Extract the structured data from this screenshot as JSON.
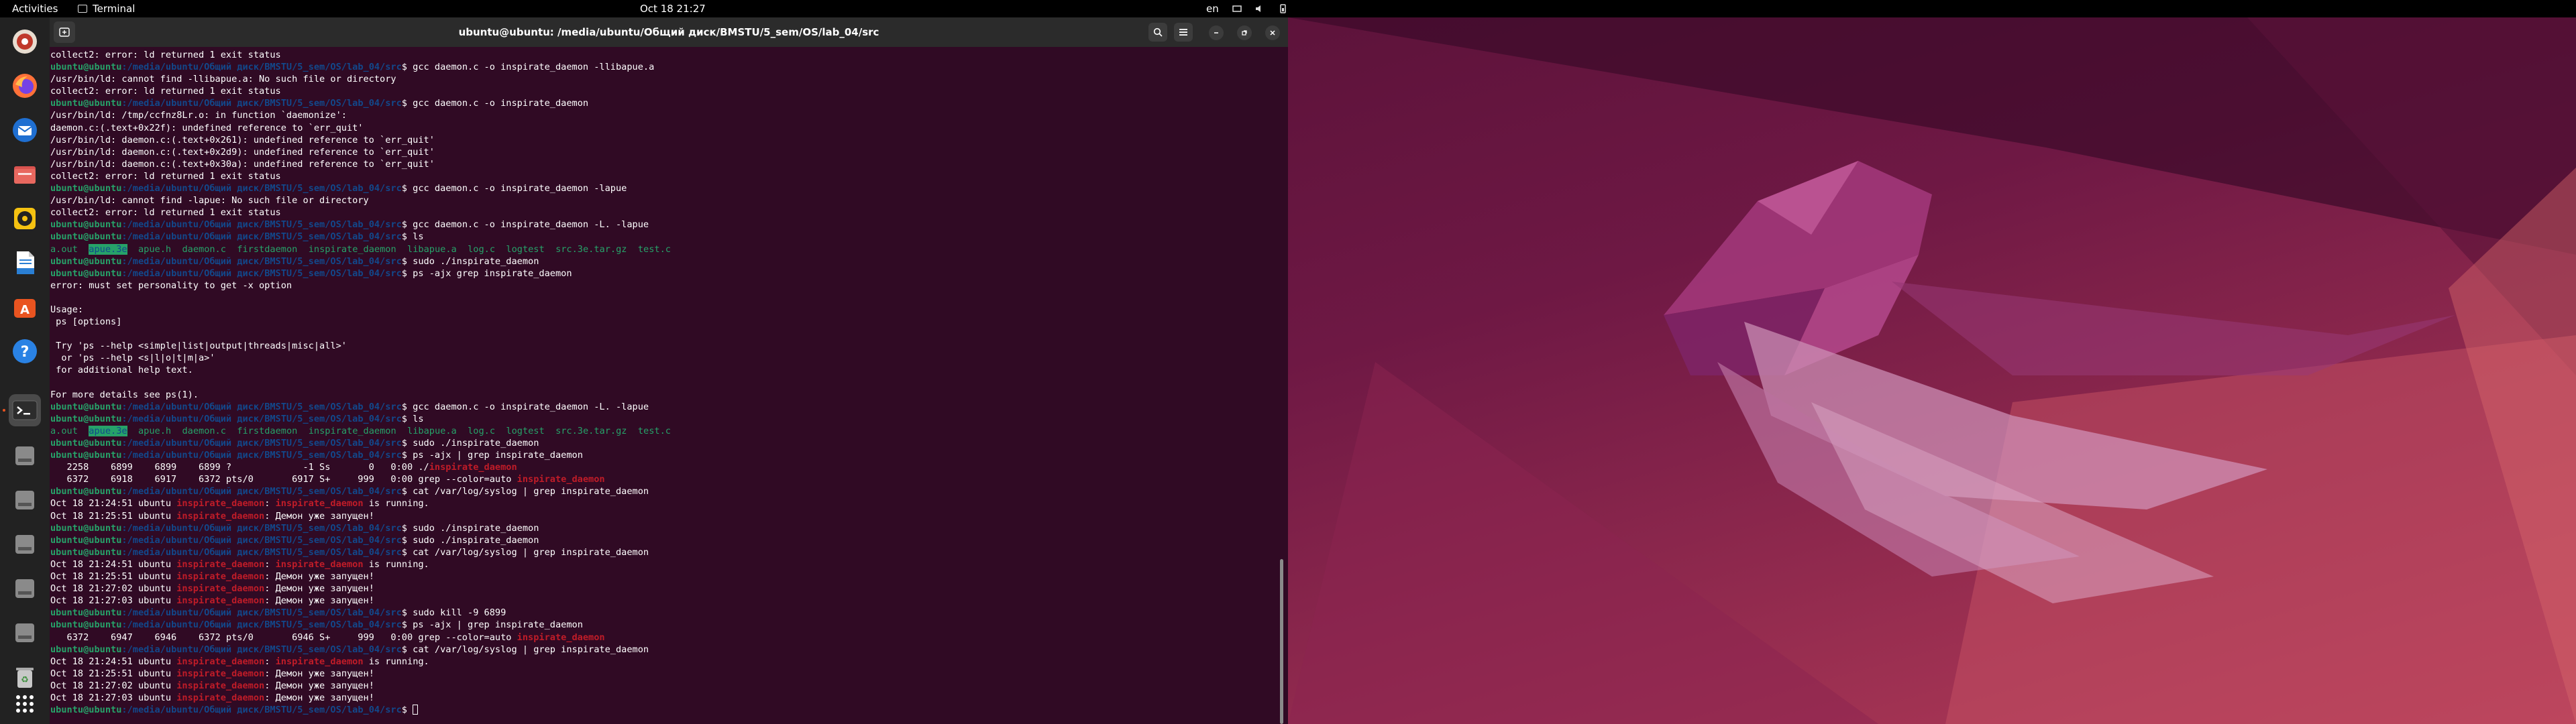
{
  "topbar": {
    "activities": "Activities",
    "app_name": "Terminal",
    "clock": "Oct 18  21:27",
    "keyboard_layout": "en"
  },
  "dock": {
    "icons": [
      "helper-app-icon",
      "firefox-icon",
      "thunderbird-icon",
      "files-icon",
      "rhythmbox-icon",
      "libreoffice-writer-icon",
      "app-center-icon",
      "help-icon",
      "terminal-icon",
      "drive-icon",
      "drive-icon",
      "drive-icon",
      "drive-icon",
      "drive-icon",
      "trash-icon",
      "show-apps-icon"
    ]
  },
  "window": {
    "title": "ubuntu@ubuntu: /media/ubuntu/Общий диск/BMSTU/5_sem/OS/lab_04/src"
  },
  "terminal": {
    "prompt_user": "ubuntu@ubuntu",
    "prompt_path": ":/media/ubuntu/Общий диск/BMSTU/5_sem/OS/lab_04/src",
    "lines": [
      [
        {
          "t": "collect2: error: ld returned 1 exit status"
        }
      ],
      [
        {
          "t": "ubuntu@ubuntu",
          "c": "p-user"
        },
        {
          "t": ":/media/ubuntu/Общий диск/BMSTU/5_sem/OS/lab_04/src",
          "c": "p-path"
        },
        {
          "t": "$ gcc daemon.c -o inspirate_daemon -llibapue.a"
        }
      ],
      [
        {
          "t": "/usr/bin/ld: cannot find -llibapue.a: No such file or directory"
        }
      ],
      [
        {
          "t": "collect2: error: ld returned 1 exit status"
        }
      ],
      [
        {
          "t": "ubuntu@ubuntu",
          "c": "p-user"
        },
        {
          "t": ":/media/ubuntu/Общий диск/BMSTU/5_sem/OS/lab_04/src",
          "c": "p-path"
        },
        {
          "t": "$ gcc daemon.c -o inspirate_daemon"
        }
      ],
      [
        {
          "t": "/usr/bin/ld: /tmp/ccfnz8Lr.o: in function `daemonize':"
        }
      ],
      [
        {
          "t": "daemon.c:(.text+0x22f): undefined reference to `err_quit'"
        }
      ],
      [
        {
          "t": "/usr/bin/ld: daemon.c:(.text+0x261): undefined reference to `err_quit'"
        }
      ],
      [
        {
          "t": "/usr/bin/ld: daemon.c:(.text+0x2d9): undefined reference to `err_quit'"
        }
      ],
      [
        {
          "t": "/usr/bin/ld: daemon.c:(.text+0x30a): undefined reference to `err_quit'"
        }
      ],
      [
        {
          "t": "collect2: error: ld returned 1 exit status"
        }
      ],
      [
        {
          "t": "ubuntu@ubuntu",
          "c": "p-user"
        },
        {
          "t": ":/media/ubuntu/Общий диск/BMSTU/5_sem/OS/lab_04/src",
          "c": "p-path"
        },
        {
          "t": "$ gcc daemon.c -o inspirate_daemon -lapue"
        }
      ],
      [
        {
          "t": "/usr/bin/ld: cannot find -lapue: No such file or directory"
        }
      ],
      [
        {
          "t": "collect2: error: ld returned 1 exit status"
        }
      ],
      [
        {
          "t": "ubuntu@ubuntu",
          "c": "p-user"
        },
        {
          "t": ":/media/ubuntu/Общий диск/BMSTU/5_sem/OS/lab_04/src",
          "c": "p-path"
        },
        {
          "t": "$ gcc daemon.c -o inspirate_daemon -L. -lapue"
        }
      ],
      [
        {
          "t": "ubuntu@ubuntu",
          "c": "p-user"
        },
        {
          "t": ":/media/ubuntu/Общий диск/BMSTU/5_sem/OS/lab_04/src",
          "c": "p-path"
        },
        {
          "t": "$ ls"
        }
      ],
      [
        {
          "t": "a.out",
          "c": "g"
        },
        {
          "t": "  "
        },
        {
          "t": "apue.3e",
          "c": "dir"
        },
        {
          "t": "  "
        },
        {
          "t": "apue.h",
          "c": "g"
        },
        {
          "t": "  "
        },
        {
          "t": "daemon.c",
          "c": "g"
        },
        {
          "t": "  "
        },
        {
          "t": "firstdaemon",
          "c": "g"
        },
        {
          "t": "  "
        },
        {
          "t": "inspirate_daemon",
          "c": "g"
        },
        {
          "t": "  "
        },
        {
          "t": "libapue.a",
          "c": "g"
        },
        {
          "t": "  "
        },
        {
          "t": "log.c",
          "c": "g"
        },
        {
          "t": "  "
        },
        {
          "t": "logtest",
          "c": "g"
        },
        {
          "t": "  "
        },
        {
          "t": "src.3e.tar.gz",
          "c": "g"
        },
        {
          "t": "  "
        },
        {
          "t": "test.c",
          "c": "g"
        }
      ],
      [
        {
          "t": "ubuntu@ubuntu",
          "c": "p-user"
        },
        {
          "t": ":/media/ubuntu/Общий диск/BMSTU/5_sem/OS/lab_04/src",
          "c": "p-path"
        },
        {
          "t": "$ sudo ./inspirate_daemon"
        }
      ],
      [
        {
          "t": "ubuntu@ubuntu",
          "c": "p-user"
        },
        {
          "t": ":/media/ubuntu/Общий диск/BMSTU/5_sem/OS/lab_04/src",
          "c": "p-path"
        },
        {
          "t": "$ ps -ajx grep inspirate_daemon"
        }
      ],
      [
        {
          "t": "error: must set personality to get -x option"
        }
      ],
      [
        {
          "t": ""
        }
      ],
      [
        {
          "t": "Usage:"
        }
      ],
      [
        {
          "t": " ps [options]"
        }
      ],
      [
        {
          "t": ""
        }
      ],
      [
        {
          "t": " Try 'ps --help <simple|list|output|threads|misc|all>'"
        }
      ],
      [
        {
          "t": "  or 'ps --help <s|l|o|t|m|a>'"
        }
      ],
      [
        {
          "t": " for additional help text."
        }
      ],
      [
        {
          "t": ""
        }
      ],
      [
        {
          "t": "For more details see ps(1)."
        }
      ],
      [
        {
          "t": "ubuntu@ubuntu",
          "c": "p-user"
        },
        {
          "t": ":/media/ubuntu/Общий диск/BMSTU/5_sem/OS/lab_04/src",
          "c": "p-path"
        },
        {
          "t": "$ gcc daemon.c -o inspirate_daemon -L. -lapue"
        }
      ],
      [
        {
          "t": "ubuntu@ubuntu",
          "c": "p-user"
        },
        {
          "t": ":/media/ubuntu/Общий диск/BMSTU/5_sem/OS/lab_04/src",
          "c": "p-path"
        },
        {
          "t": "$ ls"
        }
      ],
      [
        {
          "t": "a.out",
          "c": "g"
        },
        {
          "t": "  "
        },
        {
          "t": "apue.3e",
          "c": "dir"
        },
        {
          "t": "  "
        },
        {
          "t": "apue.h",
          "c": "g"
        },
        {
          "t": "  "
        },
        {
          "t": "daemon.c",
          "c": "g"
        },
        {
          "t": "  "
        },
        {
          "t": "firstdaemon",
          "c": "g"
        },
        {
          "t": "  "
        },
        {
          "t": "inspirate_daemon",
          "c": "g"
        },
        {
          "t": "  "
        },
        {
          "t": "libapue.a",
          "c": "g"
        },
        {
          "t": "  "
        },
        {
          "t": "log.c",
          "c": "g"
        },
        {
          "t": "  "
        },
        {
          "t": "logtest",
          "c": "g"
        },
        {
          "t": "  "
        },
        {
          "t": "src.3e.tar.gz",
          "c": "g"
        },
        {
          "t": "  "
        },
        {
          "t": "test.c",
          "c": "g"
        }
      ],
      [
        {
          "t": "ubuntu@ubuntu",
          "c": "p-user"
        },
        {
          "t": ":/media/ubuntu/Общий диск/BMSTU/5_sem/OS/lab_04/src",
          "c": "p-path"
        },
        {
          "t": "$ sudo ./inspirate_daemon"
        }
      ],
      [
        {
          "t": "ubuntu@ubuntu",
          "c": "p-user"
        },
        {
          "t": ":/media/ubuntu/Общий диск/BMSTU/5_sem/OS/lab_04/src",
          "c": "p-path"
        },
        {
          "t": "$ ps -ajx | grep inspirate_daemon"
        }
      ],
      [
        {
          "t": "   2258    6899    6899    6899 ?             -1 Ss       0   0:00 ./"
        },
        {
          "t": "inspirate_daemon",
          "c": "r"
        }
      ],
      [
        {
          "t": "   6372    6918    6917    6372 pts/0       6917 S+     999   0:00 grep --color=auto "
        },
        {
          "t": "inspirate_daemon",
          "c": "r"
        }
      ],
      [
        {
          "t": "ubuntu@ubuntu",
          "c": "p-user"
        },
        {
          "t": ":/media/ubuntu/Общий диск/BMSTU/5_sem/OS/lab_04/src",
          "c": "p-path"
        },
        {
          "t": "$ cat /var/log/syslog | grep inspirate_daemon"
        }
      ],
      [
        {
          "t": "Oct 18 21:24:51 ubuntu "
        },
        {
          "t": "inspirate_daemon",
          "c": "r"
        },
        {
          "t": ": "
        },
        {
          "t": "inspirate_daemon",
          "c": "r"
        },
        {
          "t": " is running."
        }
      ],
      [
        {
          "t": "Oct 18 21:25:51 ubuntu "
        },
        {
          "t": "inspirate_daemon",
          "c": "r"
        },
        {
          "t": ": Демон уже запущен!"
        }
      ],
      [
        {
          "t": "ubuntu@ubuntu",
          "c": "p-user"
        },
        {
          "t": ":/media/ubuntu/Общий диск/BMSTU/5_sem/OS/lab_04/src",
          "c": "p-path"
        },
        {
          "t": "$ sudo ./inspirate_daemon"
        }
      ],
      [
        {
          "t": "ubuntu@ubuntu",
          "c": "p-user"
        },
        {
          "t": ":/media/ubuntu/Общий диск/BMSTU/5_sem/OS/lab_04/src",
          "c": "p-path"
        },
        {
          "t": "$ sudo ./inspirate_daemon"
        }
      ],
      [
        {
          "t": "ubuntu@ubuntu",
          "c": "p-user"
        },
        {
          "t": ":/media/ubuntu/Общий диск/BMSTU/5_sem/OS/lab_04/src",
          "c": "p-path"
        },
        {
          "t": "$ cat /var/log/syslog | grep inspirate_daemon"
        }
      ],
      [
        {
          "t": "Oct 18 21:24:51 ubuntu "
        },
        {
          "t": "inspirate_daemon",
          "c": "r"
        },
        {
          "t": ": "
        },
        {
          "t": "inspirate_daemon",
          "c": "r"
        },
        {
          "t": " is running."
        }
      ],
      [
        {
          "t": "Oct 18 21:25:51 ubuntu "
        },
        {
          "t": "inspirate_daemon",
          "c": "r"
        },
        {
          "t": ": Демон уже запущен!"
        }
      ],
      [
        {
          "t": "Oct 18 21:27:02 ubuntu "
        },
        {
          "t": "inspirate_daemon",
          "c": "r"
        },
        {
          "t": ": Демон уже запущен!"
        }
      ],
      [
        {
          "t": "Oct 18 21:27:03 ubuntu "
        },
        {
          "t": "inspirate_daemon",
          "c": "r"
        },
        {
          "t": ": Демон уже запущен!"
        }
      ],
      [
        {
          "t": "ubuntu@ubuntu",
          "c": "p-user"
        },
        {
          "t": ":/media/ubuntu/Общий диск/BMSTU/5_sem/OS/lab_04/src",
          "c": "p-path"
        },
        {
          "t": "$ sudo kill -9 6899"
        }
      ],
      [
        {
          "t": "ubuntu@ubuntu",
          "c": "p-user"
        },
        {
          "t": ":/media/ubuntu/Общий диск/BMSTU/5_sem/OS/lab_04/src",
          "c": "p-path"
        },
        {
          "t": "$ ps -ajx | grep inspirate_daemon"
        }
      ],
      [
        {
          "t": "   6372    6947    6946    6372 pts/0       6946 S+     999   0:00 grep --color=auto "
        },
        {
          "t": "inspirate_daemon",
          "c": "r"
        }
      ],
      [
        {
          "t": "ubuntu@ubuntu",
          "c": "p-user"
        },
        {
          "t": ":/media/ubuntu/Общий диск/BMSTU/5_sem/OS/lab_04/src",
          "c": "p-path"
        },
        {
          "t": "$ cat /var/log/syslog | grep inspirate_daemon"
        }
      ],
      [
        {
          "t": "Oct 18 21:24:51 ubuntu "
        },
        {
          "t": "inspirate_daemon",
          "c": "r"
        },
        {
          "t": ": "
        },
        {
          "t": "inspirate_daemon",
          "c": "r"
        },
        {
          "t": " is running."
        }
      ],
      [
        {
          "t": "Oct 18 21:25:51 ubuntu "
        },
        {
          "t": "inspirate_daemon",
          "c": "r"
        },
        {
          "t": ": Демон уже запущен!"
        }
      ],
      [
        {
          "t": "Oct 18 21:27:02 ubuntu "
        },
        {
          "t": "inspirate_daemon",
          "c": "r"
        },
        {
          "t": ": Демон уже запущен!"
        }
      ],
      [
        {
          "t": "Oct 18 21:27:03 ubuntu "
        },
        {
          "t": "inspirate_daemon",
          "c": "r"
        },
        {
          "t": ": Демон уже запущен!"
        }
      ],
      [
        {
          "t": "ubuntu@ubuntu",
          "c": "p-user"
        },
        {
          "t": ":/media/ubuntu/Общий диск/BMSTU/5_sem/OS/lab_04/src",
          "c": "p-path"
        },
        {
          "t": "$ "
        },
        {
          "t": "",
          "c": "cursor"
        }
      ]
    ]
  }
}
